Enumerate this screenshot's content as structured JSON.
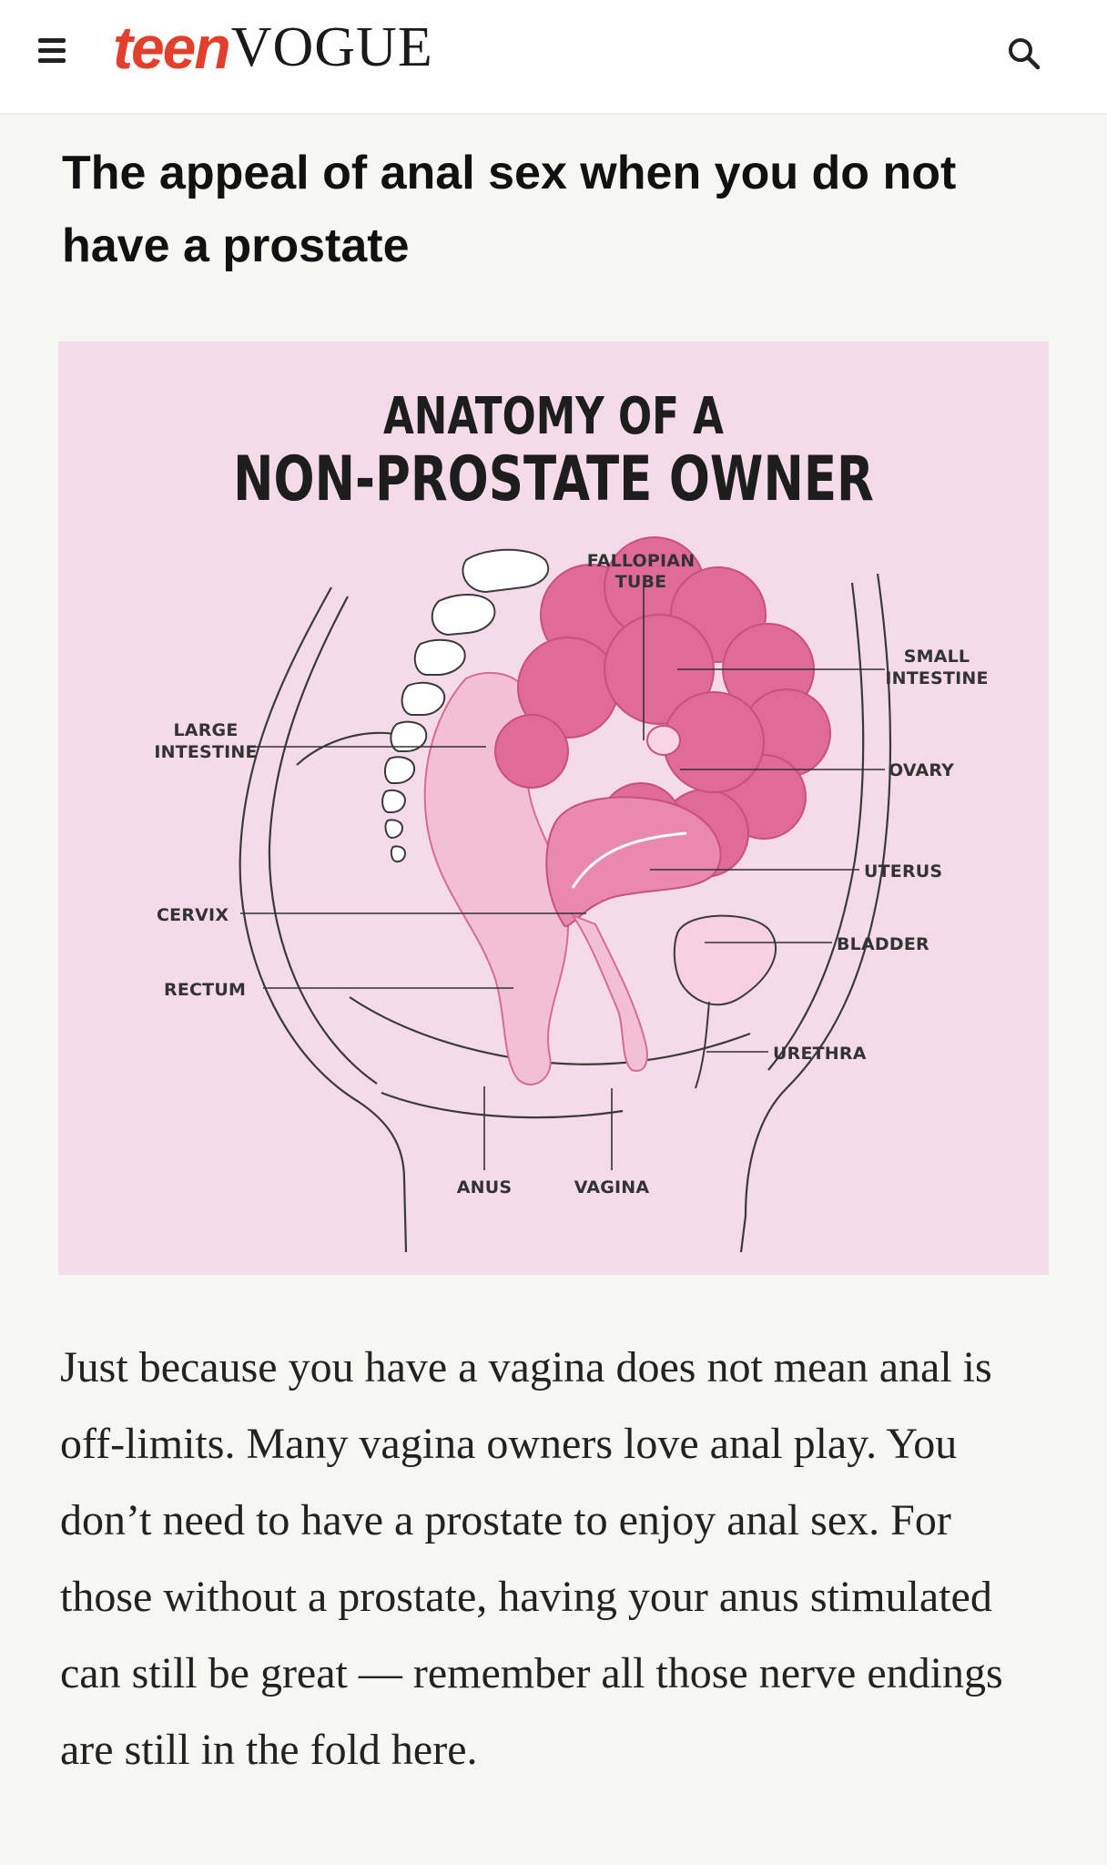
{
  "header": {
    "menu_icon": "hamburger-menu-icon",
    "logo_teen": "teen",
    "logo_vogue": "VOGUE",
    "search_icon": "search-icon"
  },
  "article": {
    "headline": "The appeal of anal sex when you do not have a prostate",
    "body": "Just because you have a vagina does not mean anal is off-limits. Many vagina owners love anal play. You don’t need to have a prostate to enjoy anal sex. For those without a prostate, having your anus stimulated can still be great — remember all those nerve endings are still in the fold here."
  },
  "figure": {
    "title_line1": "ANATOMY OF A",
    "title_line2": "NON-PROSTATE OWNER",
    "labels": {
      "fallopian_1": "FALLOPIAN",
      "fallopian_2": "TUBE",
      "small_intestine_1": "SMALL",
      "small_intestine_2": "INTESTINE",
      "large_intestine_1": "LARGE",
      "large_intestine_2": "INTESTINE",
      "ovary": "OVARY",
      "uterus": "UTERUS",
      "cervix": "CERVIX",
      "bladder": "BLADDER",
      "rectum": "RECTUM",
      "urethra": "URETHRA",
      "anus": "ANUS",
      "vagina": "VAGINA"
    },
    "colors": {
      "background": "#f5dbe9",
      "intestine": "#e06b98",
      "uterus": "#e989b0",
      "light_pink": "#f3bfd5",
      "outline": "#3a3a3a"
    }
  }
}
